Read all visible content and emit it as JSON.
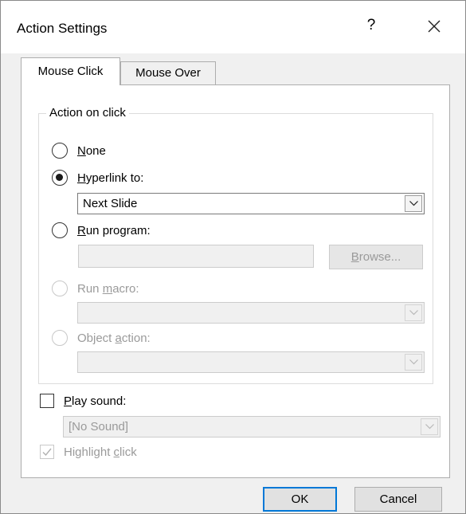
{
  "dialog": {
    "title": "Action Settings",
    "help_symbol": "?",
    "close_symbol": "×"
  },
  "tabs": [
    {
      "label": "Mouse Click",
      "active": true
    },
    {
      "label": "Mouse Over",
      "active": false
    }
  ],
  "action_group": {
    "legend": "Action on click",
    "options": [
      {
        "before": "",
        "key": "N",
        "after": "one",
        "checked": false,
        "enabled": true
      },
      {
        "before": "",
        "key": "H",
        "after": "yperlink to:",
        "checked": true,
        "enabled": true
      },
      {
        "before": "",
        "key": "R",
        "after": "un program:",
        "checked": false,
        "enabled": true
      },
      {
        "before": "Run ",
        "key": "m",
        "after": "acro:",
        "checked": false,
        "enabled": false
      },
      {
        "before": "Object ",
        "key": "a",
        "after": "ction:",
        "checked": false,
        "enabled": false
      }
    ],
    "hyperlink_value": "Next Slide",
    "run_program_value": "",
    "browse": {
      "key": "B",
      "after": "rowse..."
    },
    "macro_value": "",
    "object_action_value": ""
  },
  "play_sound": {
    "key": "P",
    "after": "lay sound:",
    "checked": false,
    "value": "[No Sound]"
  },
  "highlight_click": {
    "before": "Highlight ",
    "key": "c",
    "after": "lick",
    "checked": true,
    "enabled": false
  },
  "buttons": {
    "ok": "OK",
    "cancel": "Cancel"
  }
}
